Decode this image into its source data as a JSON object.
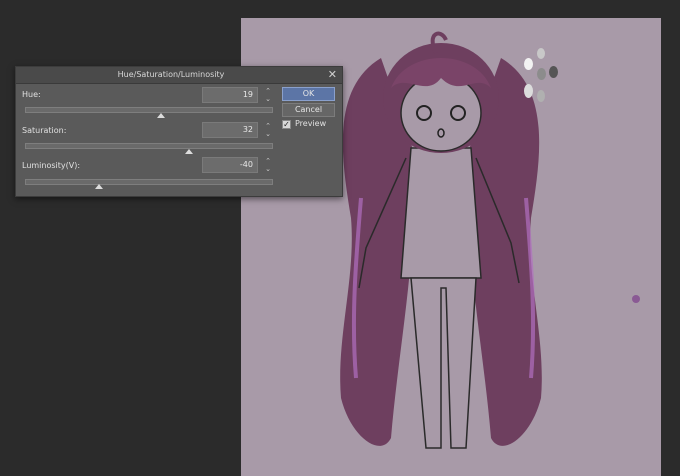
{
  "dialog": {
    "title": "Hue/Saturation/Luminosity",
    "close_glyph": "✕",
    "params": [
      {
        "label": "Hue:",
        "value": "19",
        "slider_fraction": 0.55
      },
      {
        "label": "Saturation:",
        "value": "32",
        "slider_fraction": 0.66
      },
      {
        "label": "Luminosity(V):",
        "value": "-40",
        "slider_fraction": 0.3
      }
    ],
    "spin_up": "⌃",
    "spin_down": "⌄",
    "ok_label": "OK",
    "cancel_label": "Cancel",
    "preview_label": "Preview",
    "preview_checked": true,
    "check_glyph": "✓"
  },
  "colors": {
    "app_background": "#2b2b2b",
    "artboard": "#a89aa8",
    "hair": "#6e3f5f",
    "hair_highlight": "#b06fc0",
    "accent_dot": "#8a5a94"
  }
}
